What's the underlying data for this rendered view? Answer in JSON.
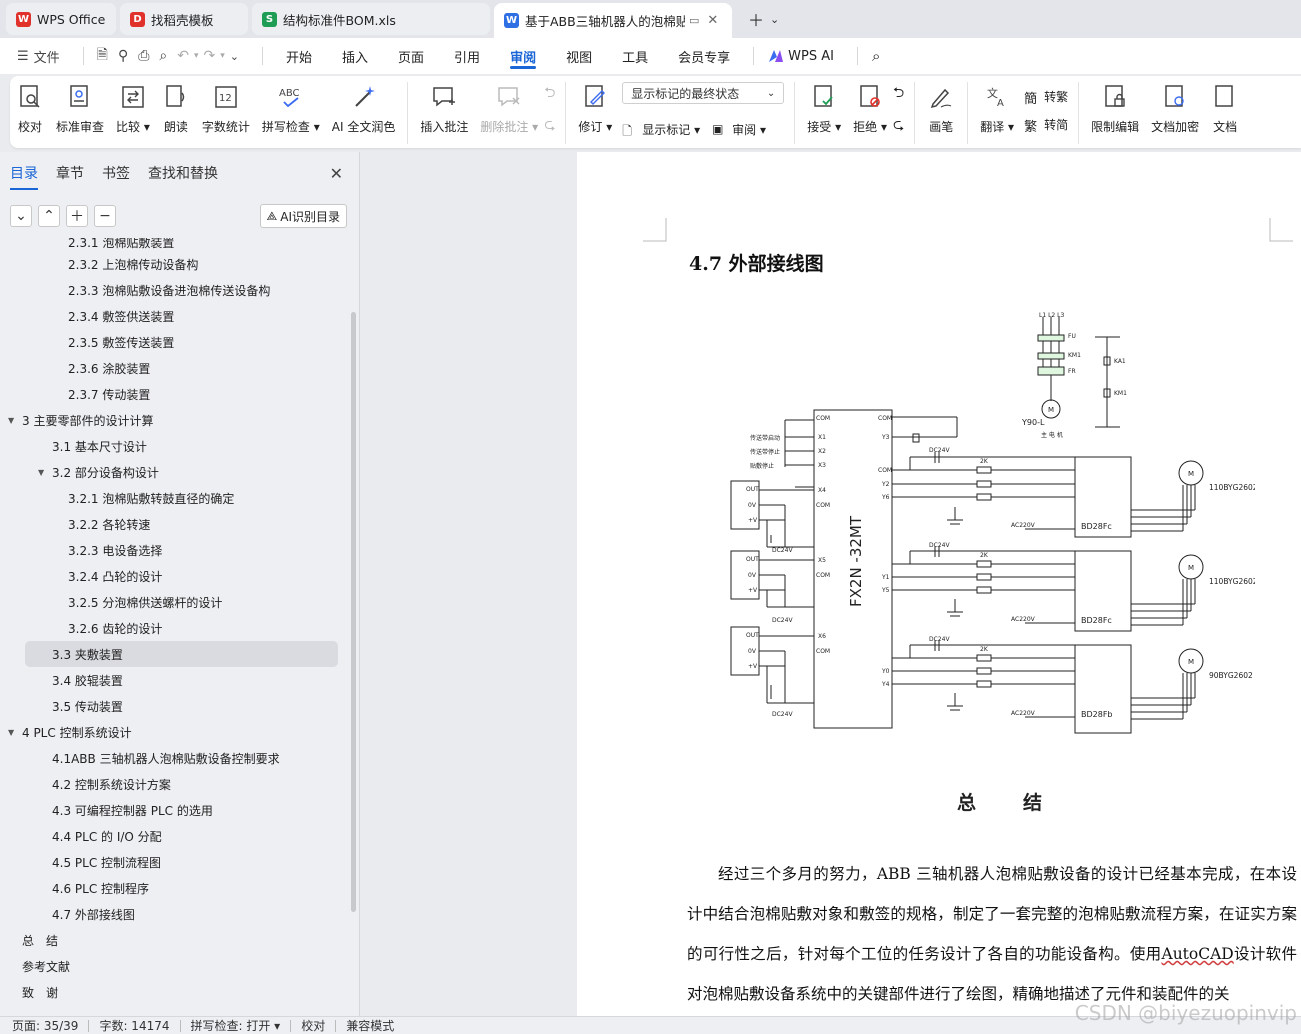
{
  "tabs": [
    {
      "label": "WPS Office",
      "icon": "wps-logo-icon",
      "color": "#e0312b"
    },
    {
      "label": "找稻壳模板",
      "icon": "docer-icon",
      "color": "#e0312b"
    },
    {
      "label": "结构标准件BOM.xls",
      "icon": "spreadsheet-icon",
      "color": "#1f9d55"
    },
    {
      "label": "基于ABB三轴机器人的泡棉贴",
      "icon": "word-doc-icon",
      "color": "#2f6fe4"
    }
  ],
  "menu": {
    "file": "文件",
    "items": [
      "开始",
      "插入",
      "页面",
      "引用",
      "审阅",
      "视图",
      "工具",
      "会员专享"
    ],
    "active": "审阅",
    "wps_ai": "WPS AI"
  },
  "ribbon": {
    "proofread": "校对",
    "standard_review": "标准审查",
    "compare": "比较",
    "read_aloud": "朗读",
    "word_count": "字数统计",
    "spell_check": "拼写检查",
    "ai_polish": "AI 全文润色",
    "insert_comment": "插入批注",
    "delete_comment": "删除批注",
    "track_changes": "修订",
    "markup_dropdown": "显示标记的最终状态",
    "show_markup": "显示标记",
    "review": "审阅",
    "accept": "接受",
    "reject": "拒绝",
    "pen": "画笔",
    "translate": "翻译",
    "to_traditional": "转繁",
    "to_simplified": "转简",
    "restrict_edit": "限制编辑",
    "doc_encrypt": "文档加密",
    "doc_more": "文档"
  },
  "panel": {
    "tabs": [
      "目录",
      "章节",
      "书签",
      "查找和替换"
    ],
    "active_tab": "目录",
    "ai_toc": "AI识别目录",
    "toc": [
      {
        "label": "2.3.1 泡棉贴敷装置",
        "level": 3
      },
      {
        "label": "2.3.2 上泡棉传动设备构",
        "level": 3
      },
      {
        "label": "2.3.3 泡棉贴敷设备进泡棉传送设备构",
        "level": 3
      },
      {
        "label": "2.3.4 敷签供送装置",
        "level": 3
      },
      {
        "label": "2.3.5 敷签传送装置",
        "level": 3
      },
      {
        "label": "2.3.6 涂胶装置",
        "level": 3
      },
      {
        "label": "2.3.7 传动装置",
        "level": 3
      },
      {
        "label": "3 主要零部件的设计计算",
        "level": 1,
        "expanded": true
      },
      {
        "label": "3.1 基本尺寸设计",
        "level": 2
      },
      {
        "label": "3.2 部分设备构设计",
        "level": 2,
        "expanded": true
      },
      {
        "label": "3.2.1 泡棉贴敷转鼓直径的确定",
        "level": 3
      },
      {
        "label": "3.2.2 各轮转速",
        "level": 3
      },
      {
        "label": "3.2.3 电设备选择",
        "level": 3
      },
      {
        "label": "3.2.4 凸轮的设计",
        "level": 3
      },
      {
        "label": "3.2.5 分泡棉供送螺杆的设计",
        "level": 3
      },
      {
        "label": "3.2.6 齿轮的设计",
        "level": 3
      },
      {
        "label": "3.3 夹敷装置",
        "level": 2,
        "selected": true
      },
      {
        "label": "3.4 胶辊装置",
        "level": 2
      },
      {
        "label": "3.5 传动装置",
        "level": 2
      },
      {
        "label": "4 PLC 控制系统设计",
        "level": 1,
        "expanded": true
      },
      {
        "label": "4.1ABB 三轴机器人泡棉贴敷设备控制要求",
        "level": 2
      },
      {
        "label": "4.2 控制系统设计方案",
        "level": 2
      },
      {
        "label": "4.3 可编程控制器 PLC 的选用",
        "level": 2
      },
      {
        "label": "4.4 PLC 的 I/O 分配",
        "level": 2
      },
      {
        "label": "4.5 PLC 控制流程图",
        "level": 2
      },
      {
        "label": "4.6 PLC 控制程序",
        "level": 2
      },
      {
        "label": "4.7 外部接线图",
        "level": 2
      },
      {
        "label": "总　结",
        "level": 1
      },
      {
        "label": "参考文献",
        "level": 1
      },
      {
        "label": "致　谢",
        "level": 1
      }
    ]
  },
  "doc": {
    "heading": "4.7 外部接线图",
    "diagram": {
      "plc_label": "FX2N -32MT",
      "input_labels": [
        "传送带启动",
        "传送带停止",
        "贴敷停止"
      ],
      "power_labels": [
        "FU",
        "KM1",
        "FR",
        "KA1",
        "KM1"
      ],
      "motor_label": "Y90-L",
      "motor_caption": "主 电 机",
      "dc_label": "DC24V",
      "ac_label": "AC220V",
      "res_label": "2K",
      "drivers": [
        {
          "name": "BD28Fc",
          "motor": "110BYG2602"
        },
        {
          "name": "BD28Fc",
          "motor": "110BYG2602"
        },
        {
          "name": "BD28Fb",
          "motor": "90BYG2602"
        }
      ],
      "plc_pins_left": [
        "COM",
        "X1",
        "X2",
        "X3",
        "X4",
        "COM",
        "X5",
        "COM",
        "X6",
        "COM"
      ],
      "plc_pins_right": [
        "COM",
        "Y3",
        "COM",
        "Y2",
        "Y6",
        "Y1",
        "Y5",
        "Y0",
        "Y4"
      ],
      "sensor_pins": [
        "OUT",
        "0V",
        "+V"
      ]
    },
    "summary_title": "总　结",
    "paragraph_before": "经过三个多月的努力，ABB 三轴机器人泡棉贴敷设备的设计已经基本完成，在本设计中结合泡棉贴敷对象和敷签的规格，制定了一套完整的泡棉贴敷流程方案，在证实方案的可行性之后，针对每个工位的任务设计了各自的功能设备构。使用",
    "paragraph_underlined": "AutoCAD",
    "paragraph_after": "设计软件对泡棉贴敷设备系统中的关键部件进行了绘图，精确地描述了元件和装配件的关"
  },
  "status": {
    "page": "页面: 35/39",
    "words": "字数: 14174",
    "spell": "拼写检查: 打开",
    "proof": "校对",
    "compat": "兼容模式"
  },
  "watermark": "CSDN @biyezuopinvip"
}
